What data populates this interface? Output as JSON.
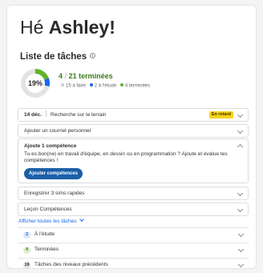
{
  "greeting": {
    "hello": "Hé",
    "name": "Ashley!"
  },
  "task_list": {
    "title": "Liste de tâches",
    "percent_label": "19%",
    "completed": "4",
    "total_label": "21 terminées",
    "legend": [
      {
        "label": "15 à faire",
        "color": "#c9c9c9"
      },
      {
        "label": "2 à l'étude",
        "color": "#1865f2"
      },
      {
        "label": "4 terminées",
        "color": "#5fb526"
      }
    ],
    "donut": {
      "done_fraction": 0.19,
      "review_fraction": 0.095,
      "done_color": "#5fb526",
      "review_color": "#1865f2",
      "todo_color": "#e3e3e3"
    }
  },
  "tasks": {
    "row1": {
      "date": "14 déc.",
      "title": "Recherche sur le terrain",
      "badge": "En retard"
    },
    "row2": {
      "title": "Ajouter un courriel personnel"
    },
    "expanded": {
      "title": "Ajoute 1 compétence",
      "description": "Tu es bon(ne) en travail d'équipe, en dessin ou en programmation ? Ajoute et évalue tes compétences !",
      "button": "Ajouter compétences"
    },
    "row4": {
      "title": "Enregistrer 3 sims rapides"
    },
    "row5": {
      "title": "Leçon Compétences"
    }
  },
  "show_all": "Afficher toutes les tâches",
  "groups": [
    {
      "count": "2",
      "label": "À l'étude"
    },
    {
      "count": "4",
      "label": "Terminées"
    },
    {
      "count": "19",
      "label": "Tâches des niveaux précédents"
    }
  ]
}
